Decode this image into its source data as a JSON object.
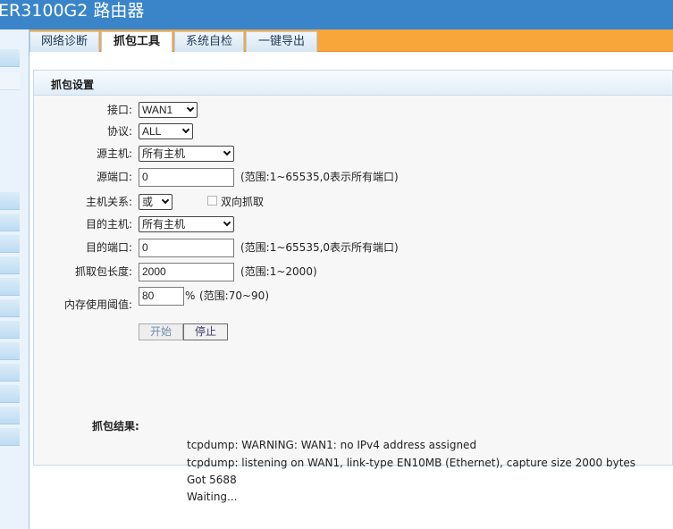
{
  "header": {
    "title": "ER3100G2 路由器"
  },
  "tabs": [
    {
      "label": "网络诊断",
      "active": false
    },
    {
      "label": "抓包工具",
      "active": true
    },
    {
      "label": "系统自检",
      "active": false
    },
    {
      "label": "一键导出",
      "active": false
    }
  ],
  "panel": {
    "title": "抓包设置"
  },
  "form": {
    "interface": {
      "label": "接口:",
      "value": "WAN1"
    },
    "protocol": {
      "label": "协议:",
      "value": "ALL"
    },
    "src_host": {
      "label": "源主机:",
      "value": "所有主机"
    },
    "src_port": {
      "label": "源端口:",
      "value": "0",
      "hint": "(范围:1~65535,0表示所有端口)"
    },
    "host_relation": {
      "label": "主机关系:",
      "value": "或",
      "bidirectional_label": "双向抓取",
      "bidirectional_checked": false
    },
    "dst_host": {
      "label": "目的主机:",
      "value": "所有主机"
    },
    "dst_port": {
      "label": "目的端口:",
      "value": "0",
      "hint": "(范围:1~65535,0表示所有端口)"
    },
    "capture_length": {
      "label": "抓取包长度:",
      "value": "2000",
      "hint": "(范围:1~2000)"
    },
    "memory_threshold": {
      "label": "内存使用阈值:",
      "value": "80",
      "unit": "%",
      "hint": "(范围:70~90)"
    }
  },
  "buttons": {
    "start": "开始",
    "stop": "停止"
  },
  "results": {
    "label": "抓包结果:",
    "lines": [
      "tcpdump: WARNING: WAN1: no IPv4 address assigned",
      "tcpdump: listening on WAN1, link-type EN10MB (Ethernet), capture size 2000 bytes",
      "Got 5688",
      "Waiting..."
    ]
  },
  "colors": {
    "header_bg": "#3a85c9",
    "tabbar_bg": "#f8a63a",
    "panel_bg": "#f7f7f7"
  }
}
